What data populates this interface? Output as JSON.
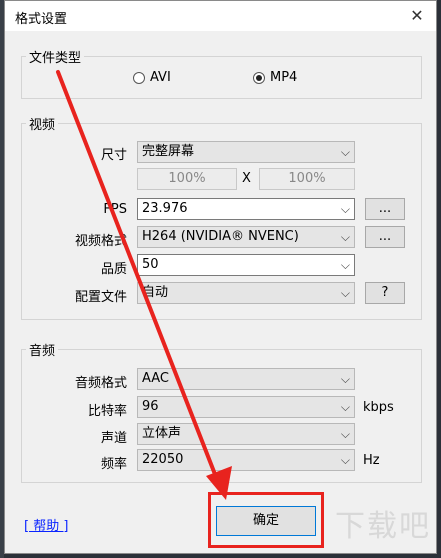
{
  "dialog": {
    "title": "格式设置",
    "close_glyph": "✕"
  },
  "file_type": {
    "legend": "文件类型",
    "options": [
      {
        "label": "AVI",
        "checked": false
      },
      {
        "label": "MP4",
        "checked": true
      }
    ]
  },
  "video": {
    "legend": "视频",
    "size_label": "尺寸",
    "size_value": "完整屏幕",
    "width_pct": "100%",
    "x_sep": "X",
    "height_pct": "100%",
    "fps_label": "FPS",
    "fps_value": "23.976",
    "fps_btn": "...",
    "format_label": "视频格式",
    "format_value": "H264 (NVIDIA® NVENC)",
    "format_btn": "...",
    "quality_label": "品质",
    "quality_value": "50",
    "profile_label": "配置文件",
    "profile_value": "自动",
    "profile_btn": "?"
  },
  "audio": {
    "legend": "音频",
    "format_label": "音频格式",
    "format_value": "AAC",
    "bitrate_label": "比特率",
    "bitrate_value": "96",
    "bitrate_unit": "kbps",
    "channel_label": "声道",
    "channel_value": "立体声",
    "freq_label": "频率",
    "freq_value": "22050",
    "freq_unit": "Hz"
  },
  "footer": {
    "help": "[ 帮助 ]",
    "ok": "确定"
  },
  "watermark": {
    "text": "下载吧"
  },
  "colors": {
    "annotation_red": "#e8231e",
    "focus_blue": "#0078d7",
    "link_blue": "#0a24ff"
  },
  "chevron_glyph": "⌵"
}
